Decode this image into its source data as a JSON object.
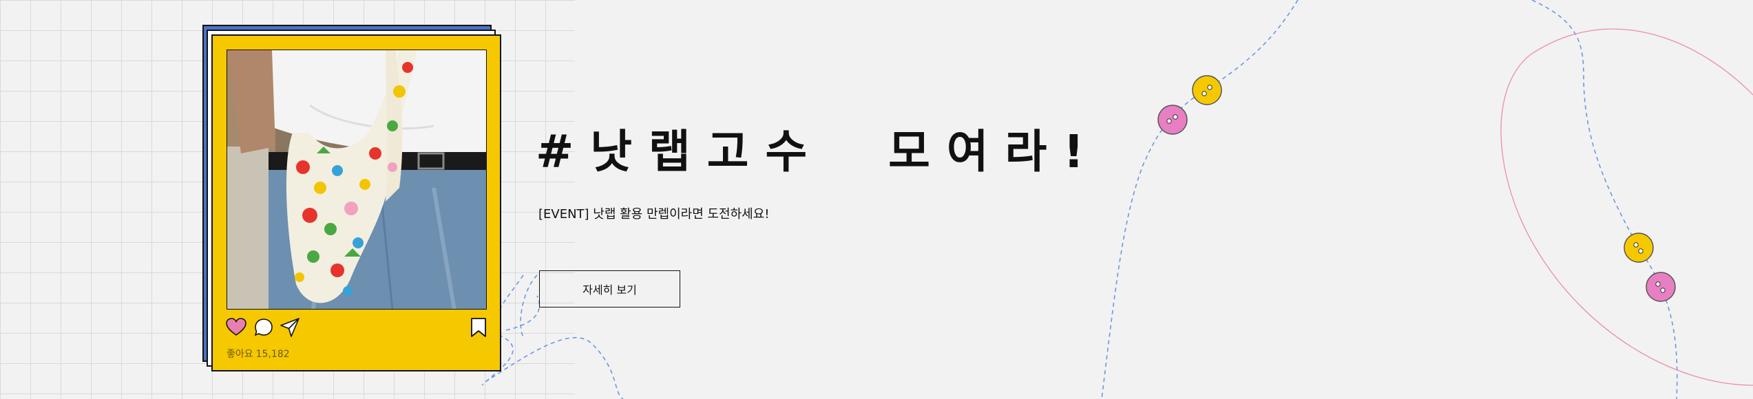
{
  "banner": {
    "headline": "#낫랩고수  모여라!",
    "subline": "[EVENT] 낫랩 활용 만렙이라면 도전하세요!",
    "detail_button_label": "자세히 보기"
  },
  "post_card": {
    "likes_label": "좋아요",
    "likes_count": "15,182",
    "icons": [
      "heart-icon",
      "comment-icon",
      "share-icon",
      "bookmark-icon"
    ]
  },
  "colors": {
    "background": "#f2f2f2",
    "card_yellow": "#f5c800",
    "card_blue": "#4a72c8",
    "heart_pink": "#e97fb0",
    "button_pink": "#e77fc2",
    "button_yellow": "#f5c800",
    "dashed_blue": "#6a98e0",
    "line_pink": "#ea8fa6"
  }
}
